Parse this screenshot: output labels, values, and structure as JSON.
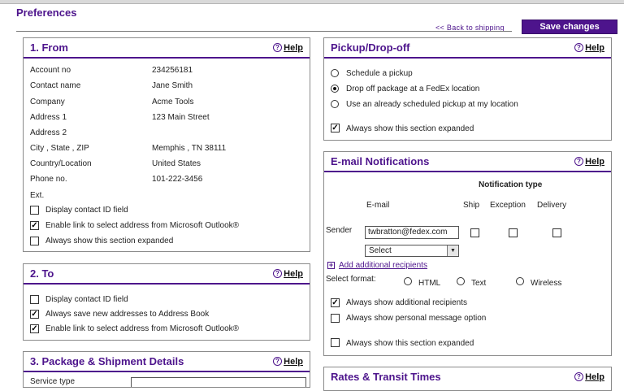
{
  "page": {
    "title": "Preferences",
    "back_link": "<< Back to shipping",
    "save_label": "Save changes"
  },
  "from": {
    "title": "1. From",
    "help": "Help",
    "fields": [
      {
        "label": "Account no",
        "value": "234256181"
      },
      {
        "label": "Contact name",
        "value": "Jane Smith"
      },
      {
        "label": "Company",
        "value": "Acme Tools"
      },
      {
        "label": "Address 1",
        "value": "123 Main Street"
      },
      {
        "label": "Address 2",
        "value": ""
      },
      {
        "label": "City , State , ZIP",
        "value": "Memphis , TN 38111"
      },
      {
        "label": "Country/Location",
        "value": "United States"
      },
      {
        "label": "Phone no.",
        "value": "101-222-3456"
      },
      {
        "label": "Ext.",
        "value": ""
      }
    ],
    "options": [
      {
        "label": "Display contact ID field",
        "checked": false
      },
      {
        "label": "Enable link to select address from Microsoft Outlook®",
        "checked": true
      },
      {
        "label": "Always show this section expanded",
        "checked": false
      }
    ]
  },
  "to": {
    "title": "2. To",
    "help": "Help",
    "options": [
      {
        "label": "Display contact ID field",
        "checked": false
      },
      {
        "label": "Always save new addresses to Address Book",
        "checked": true
      },
      {
        "label": "Enable link to select address from Microsoft Outlook®",
        "checked": true
      }
    ]
  },
  "package": {
    "title": "3. Package & Shipment Details",
    "help": "Help",
    "partial_label": "Service type"
  },
  "pickup": {
    "title": "Pickup/Drop-off",
    "help": "Help",
    "radios": [
      {
        "label": "Schedule a pickup",
        "selected": false
      },
      {
        "label": "Drop off package at a FedEx location",
        "selected": true
      },
      {
        "label": "Use an already scheduled pickup at my location",
        "selected": false
      }
    ],
    "expanded": {
      "label": "Always show this section expanded",
      "checked": true
    }
  },
  "email": {
    "title": "E-mail Notifications",
    "help": "Help",
    "notification_type": "Notification type",
    "col_email": "E-mail",
    "col_ship": "Ship",
    "col_exception": "Exception",
    "col_delivery": "Delivery",
    "sender_label": "Sender",
    "sender_value": "twbratton@fedex.com",
    "select_value": "Select",
    "add_recipients": "Add additional recipients",
    "format_label": "Select format:",
    "formats": [
      {
        "label": "HTML",
        "selected": false
      },
      {
        "label": "Text",
        "selected": false
      },
      {
        "label": "Wireless",
        "selected": false
      }
    ],
    "options": [
      {
        "label": "Always show additional recipients",
        "checked": true
      },
      {
        "label": "Always show personal message option",
        "checked": false
      },
      {
        "label": "Always show this section expanded",
        "checked": false
      }
    ]
  },
  "rates": {
    "title": "Rates & Transit Times",
    "help": "Help"
  },
  "colors": {
    "brand": "#4d148c"
  }
}
